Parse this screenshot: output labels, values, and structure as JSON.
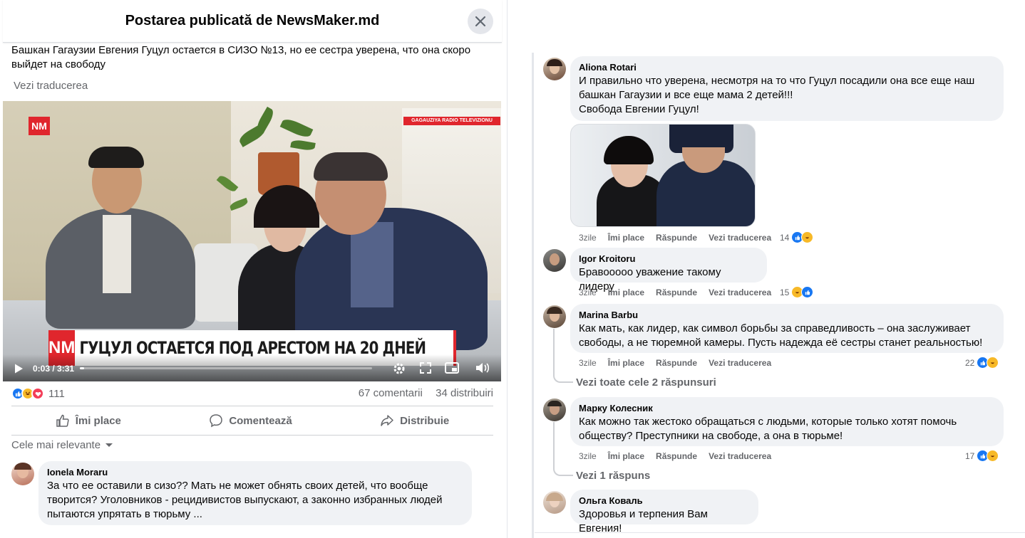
{
  "dialog": {
    "title": "Postarea publicată de NewsMaker.md"
  },
  "post": {
    "text": "Башкан Гагаузии Евгения Гуцул остается в СИЗО №13, но ее сестра уверена, что она скоро выйдет на свободу",
    "see_translation": "Vezi traducerea"
  },
  "video": {
    "logo": "NM",
    "station": "GAGAUZIYA RADIO TELEVIZIONU",
    "lower_third_logo": "NM",
    "headline": "ГУЦУЛ ОСТАЕТСЯ ПОД АРЕСТОМ НА 20 ДНЕЙ",
    "time": "0:03 / 3:31",
    "progress": 0.015
  },
  "stats": {
    "reactions_count": "111",
    "comments": "67 comentarii",
    "shares": "34 distribuiri"
  },
  "actions": {
    "like": "Îmi place",
    "comment": "Comentează",
    "share": "Distribuie"
  },
  "sort": {
    "label": "Cele mai relevante"
  },
  "comments_left": [
    {
      "name": "Ionela Moraru",
      "text": "За что ее оставили в сизо?? Мать не может обнять своих детей, что вообще творится? Уголовников - рецидивистов выпускают, а законно избранных людей пытаются упрятать в тюрьму ..."
    }
  ],
  "meta_labels": {
    "like": "Îmi place",
    "reply": "Răspunde",
    "translate": "Vezi traducerea"
  },
  "comments_right": [
    {
      "name": "Aliona Rotari",
      "text": "И правильно что уверена, несмотря на то что Гуцул посадили она все еще наш башкан Гагаузии и все еще мама 2 детей!!!\nСвобода Евгении Гуцул!",
      "time": "3zile",
      "reactions": "14"
    },
    {
      "name": "Igor Kroitoru",
      "text": "Бравооооо уважение такому лидеру",
      "time": "3zile",
      "reactions": "15"
    },
    {
      "name": "Marina Barbu",
      "text": "Как мать, как лидер, как символ борьбы за справедливость – она заслуживает свободы, а не тюремной камеры. Пусть надежда её сестры станет реальностью!",
      "time": "3zile",
      "reactions": "22",
      "replies": "Vezi toate cele 2 răspunsuri"
    },
    {
      "name": "Марку Колесник",
      "text": "Как можно так жестоко обращаться с людьми, которые только хотят помочь обществу? Преступники на свободе, а она в тюрьме!",
      "time": "3zile",
      "reactions": "17",
      "replies": "Vezi 1 răspuns"
    },
    {
      "name": "Ольга Коваль",
      "text": "Здоровья и терпения Вам Евгения!"
    }
  ],
  "colors": {
    "accent": "#1877f2",
    "news_red": "#e0262d",
    "bubble": "#f0f2f5",
    "secondary_text": "#65676b"
  }
}
